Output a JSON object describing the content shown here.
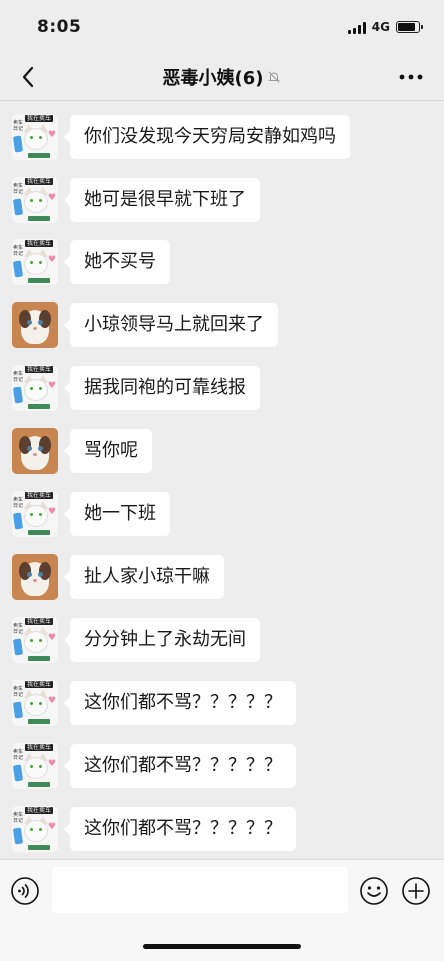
{
  "status_bar": {
    "time": "8:05",
    "network": "4G",
    "battery_level_percent": 85,
    "signal_icon": "signal-bars-icon",
    "battery_icon": "battery-icon"
  },
  "header": {
    "title": "恶毒小姨(6)",
    "back_icon": "chevron-left-icon",
    "mute_icon": "bell-muted-icon",
    "more_icon": "more-dots-icon"
  },
  "messages": [
    {
      "sender_avatar": "cat-sign-avatar",
      "text": "你们没发现今天穷局安静如鸡吗"
    },
    {
      "sender_avatar": "cat-sign-avatar",
      "text": "她可是很早就下班了"
    },
    {
      "sender_avatar": "cat-sign-avatar",
      "text": "她不买号"
    },
    {
      "sender_avatar": "ragdoll-cat-avatar",
      "text": "小琼领导马上就回来了"
    },
    {
      "sender_avatar": "cat-sign-avatar",
      "text": "据我同袍的可靠线报"
    },
    {
      "sender_avatar": "ragdoll-cat-avatar",
      "text": "骂你呢"
    },
    {
      "sender_avatar": "cat-sign-avatar",
      "text": "她一下班"
    },
    {
      "sender_avatar": "ragdoll-cat-avatar",
      "text": "扯人家小琼干嘛"
    },
    {
      "sender_avatar": "cat-sign-avatar",
      "text": "分分钟上了永劫无间"
    },
    {
      "sender_avatar": "cat-sign-avatar",
      "text": "这你们都不骂？？？？？"
    },
    {
      "sender_avatar": "cat-sign-avatar",
      "text": "这你们都不骂？？？？？"
    },
    {
      "sender_avatar": "cat-sign-avatar",
      "text": "这你们都不骂？？？？？"
    }
  ],
  "avatar_sign": {
    "top": "我在卖车",
    "left": "卖车日记"
  },
  "input_bar": {
    "placeholder": "",
    "voice_icon": "voice-icon",
    "emoji_icon": "emoji-smile-icon",
    "plus_icon": "plus-circle-icon"
  },
  "colors": {
    "background": "#ededed",
    "bubble": "#ffffff",
    "text": "#191919"
  }
}
